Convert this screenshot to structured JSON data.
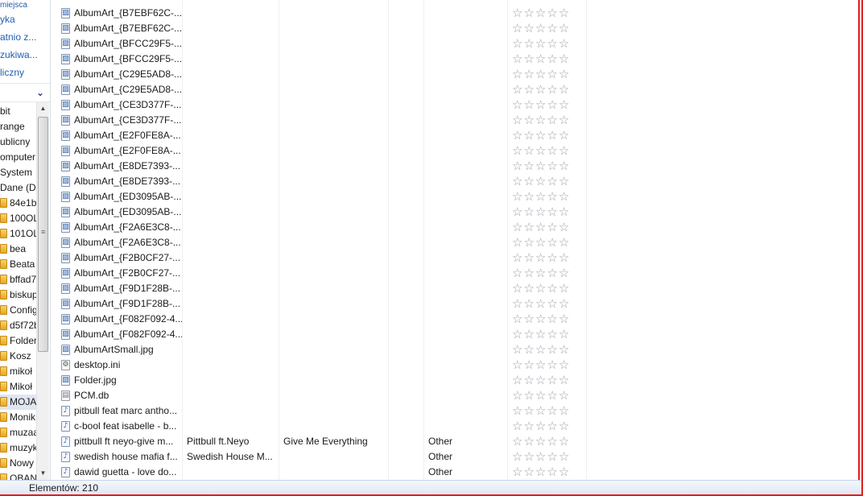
{
  "nav": {
    "favorites_clip": "ostatnie miejsca",
    "favorites": [
      "yka",
      "atnio z...",
      "zukiwa...",
      "liczny"
    ],
    "tree": [
      "bit",
      "range",
      "ublicny",
      "omputer",
      "System",
      "Dane (D",
      "84e1b",
      "100OL",
      "101OL",
      "bea",
      "Beata",
      "bffad7",
      "biskup",
      "Config",
      "d5f72b",
      "Folder",
      "Kosz",
      "mikoł",
      "Mikoł",
      "MOJA",
      "Monik",
      "muzaa",
      "muzyk",
      "Nowy",
      "OBAN"
    ],
    "selected_index": 19
  },
  "files": [
    {
      "name": "AlbumArt_{B7EBF62C-...",
      "type": "img",
      "artist": "",
      "album": "",
      "genre": ""
    },
    {
      "name": "AlbumArt_{B7EBF62C-...",
      "type": "img",
      "artist": "",
      "album": "",
      "genre": ""
    },
    {
      "name": "AlbumArt_{BFCC29F5-...",
      "type": "img",
      "artist": "",
      "album": "",
      "genre": ""
    },
    {
      "name": "AlbumArt_{BFCC29F5-...",
      "type": "img",
      "artist": "",
      "album": "",
      "genre": ""
    },
    {
      "name": "AlbumArt_{C29E5AD8-...",
      "type": "img",
      "artist": "",
      "album": "",
      "genre": ""
    },
    {
      "name": "AlbumArt_{C29E5AD8-...",
      "type": "img",
      "artist": "",
      "album": "",
      "genre": ""
    },
    {
      "name": "AlbumArt_{CE3D377F-...",
      "type": "img",
      "artist": "",
      "album": "",
      "genre": ""
    },
    {
      "name": "AlbumArt_{CE3D377F-...",
      "type": "img",
      "artist": "",
      "album": "",
      "genre": ""
    },
    {
      "name": "AlbumArt_{E2F0FE8A-...",
      "type": "img",
      "artist": "",
      "album": "",
      "genre": ""
    },
    {
      "name": "AlbumArt_{E2F0FE8A-...",
      "type": "img",
      "artist": "",
      "album": "",
      "genre": ""
    },
    {
      "name": "AlbumArt_{E8DE7393-...",
      "type": "img",
      "artist": "",
      "album": "",
      "genre": ""
    },
    {
      "name": "AlbumArt_{E8DE7393-...",
      "type": "img",
      "artist": "",
      "album": "",
      "genre": ""
    },
    {
      "name": "AlbumArt_{ED3095AB-...",
      "type": "img",
      "artist": "",
      "album": "",
      "genre": ""
    },
    {
      "name": "AlbumArt_{ED3095AB-...",
      "type": "img",
      "artist": "",
      "album": "",
      "genre": ""
    },
    {
      "name": "AlbumArt_{F2A6E3C8-...",
      "type": "img",
      "artist": "",
      "album": "",
      "genre": ""
    },
    {
      "name": "AlbumArt_{F2A6E3C8-...",
      "type": "img",
      "artist": "",
      "album": "",
      "genre": ""
    },
    {
      "name": "AlbumArt_{F2B0CF27-...",
      "type": "img",
      "artist": "",
      "album": "",
      "genre": ""
    },
    {
      "name": "AlbumArt_{F2B0CF27-...",
      "type": "img",
      "artist": "",
      "album": "",
      "genre": ""
    },
    {
      "name": "AlbumArt_{F9D1F28B-...",
      "type": "img",
      "artist": "",
      "album": "",
      "genre": ""
    },
    {
      "name": "AlbumArt_{F9D1F28B-...",
      "type": "img",
      "artist": "",
      "album": "",
      "genre": ""
    },
    {
      "name": "AlbumArt_{F082F092-4...",
      "type": "img",
      "artist": "",
      "album": "",
      "genre": ""
    },
    {
      "name": "AlbumArt_{F082F092-4...",
      "type": "img",
      "artist": "",
      "album": "",
      "genre": ""
    },
    {
      "name": "AlbumArtSmall.jpg",
      "type": "img",
      "artist": "",
      "album": "",
      "genre": ""
    },
    {
      "name": "desktop.ini",
      "type": "ini",
      "artist": "",
      "album": "",
      "genre": ""
    },
    {
      "name": "Folder.jpg",
      "type": "img",
      "artist": "",
      "album": "",
      "genre": ""
    },
    {
      "name": "PCM.db",
      "type": "db",
      "artist": "",
      "album": "",
      "genre": ""
    },
    {
      "name": "pitbull feat marc antho...",
      "type": "audio",
      "artist": "",
      "album": "",
      "genre": ""
    },
    {
      "name": "c-bool feat isabelle - b...",
      "type": "audio",
      "artist": "",
      "album": "",
      "genre": ""
    },
    {
      "name": "pittbull ft neyo-give m...",
      "type": "audio",
      "artist": "Pittbull ft.Neyo",
      "album": "Give Me Everything",
      "genre": "Other"
    },
    {
      "name": "swedish house mafia f...",
      "type": "audio",
      "artist": "Swedish House M...",
      "album": "",
      "genre": "Other"
    },
    {
      "name": "dawid guetta - love do...",
      "type": "audio",
      "artist": "",
      "album": "",
      "genre": "Other"
    }
  ],
  "rating_stars": "☆☆☆☆☆",
  "rating": 0,
  "status": {
    "text": "Elementów: 210"
  },
  "accent_color": "#e0201f"
}
